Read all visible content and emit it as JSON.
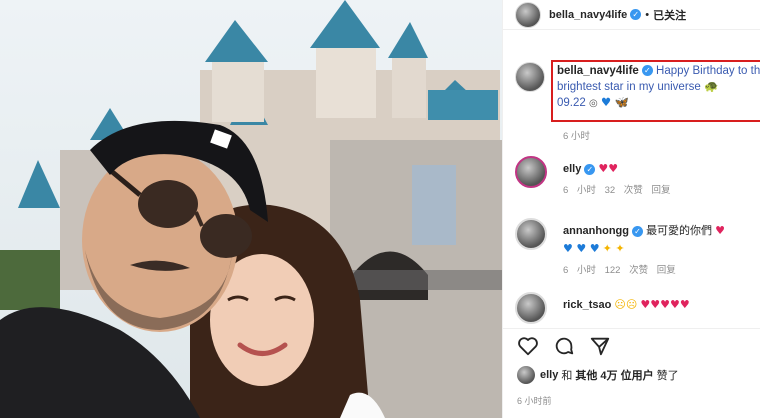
{
  "colors": {
    "accent": "#3897f0",
    "highlight_box": "#d81e1e",
    "muted": "#8e8e8e"
  },
  "header": {
    "username": "bella_navy4life",
    "separator": "•",
    "follow_label": "已关注"
  },
  "caption": {
    "username": "bella_navy4life",
    "text": "Happy Birthday to the brightest star in my universe",
    "date_text": "09.22",
    "emojis": [
      "turtle",
      "blue-heart",
      "butterfly"
    ],
    "time": "6 小时"
  },
  "comments": [
    {
      "username": "elly",
      "text": "",
      "emojis": [
        "red-heart",
        "red-heart"
      ],
      "time": "6 小时",
      "likes": "32 次赞",
      "reply": "回复"
    },
    {
      "username": "annanhongg",
      "text": "最可愛的你們",
      "emojis": [
        "red-heart",
        "blue-heart",
        "blue-heart",
        "blue-heart",
        "sparkles",
        "sparkles"
      ],
      "time": "6 小时",
      "likes": "122 次赞",
      "reply": "回复"
    },
    {
      "username": "rick_tsao",
      "text": "",
      "emojis": [
        "sad-face",
        "sad-face",
        "red-heart",
        "red-heart",
        "red-heart",
        "red-heart",
        "red-heart"
      ]
    }
  ],
  "actions": [
    "heart-icon",
    "comment-icon",
    "share-icon"
  ],
  "likes": {
    "prefix": "elly",
    "and": "和",
    "count_label": "其他 4万 位用户",
    "suffix": "赞了"
  },
  "posted": "6 小时前"
}
